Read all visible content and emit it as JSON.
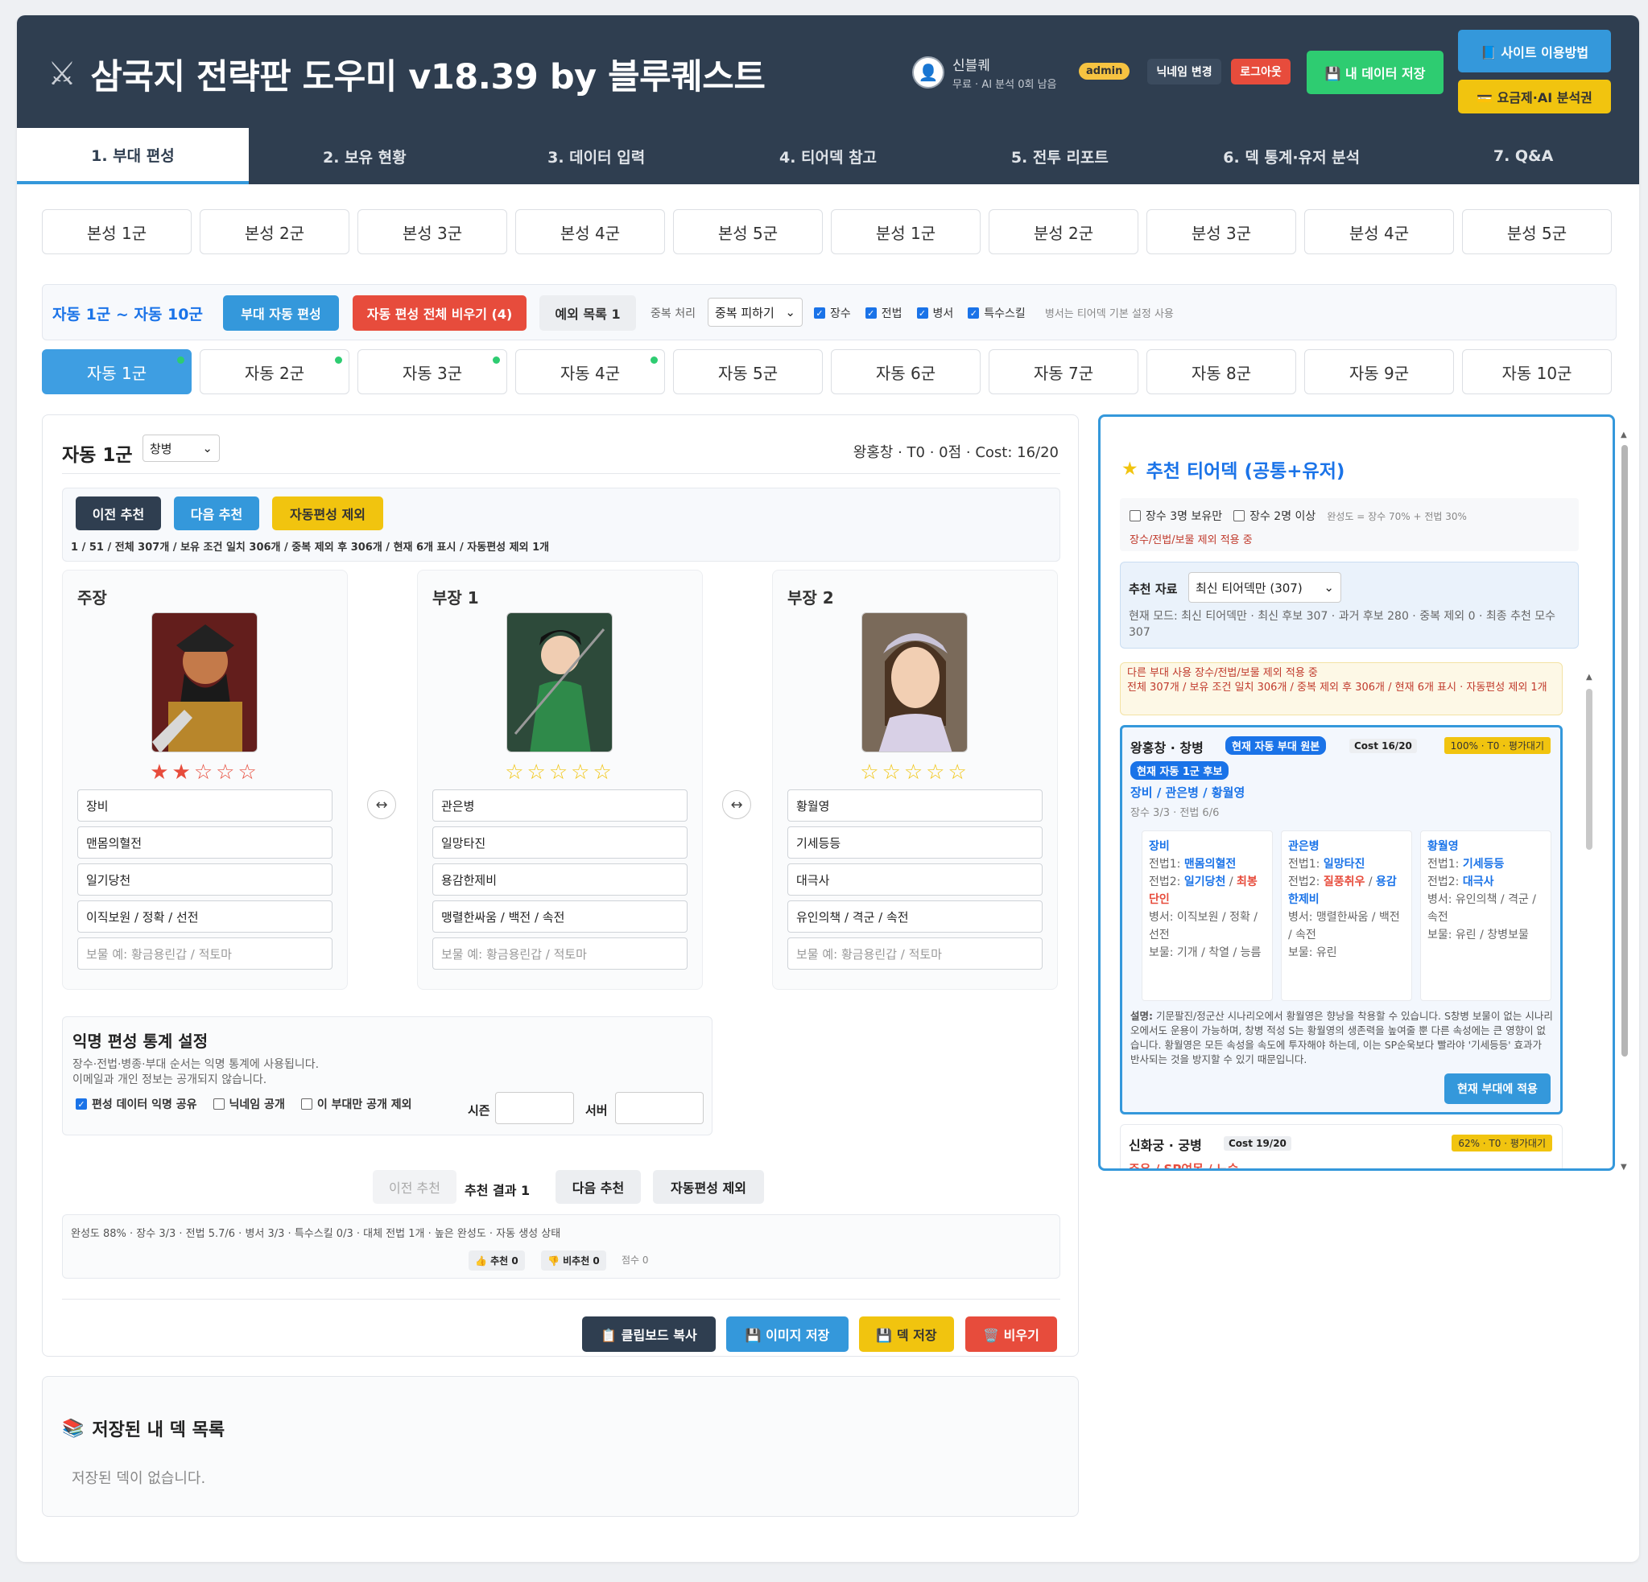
{
  "header": {
    "title": "삼국지 전략판 도우미 v18.39 by 블루퀘스트",
    "user_name": "신블퀘",
    "user_sub": "무료 · AI 분석 0회 남음",
    "admin_badge": "admin",
    "nickname_btn": "닉네임 변경",
    "logout_btn": "로그아웃",
    "save_data_btn": "💾 내 데이터 저장",
    "howto_btn": "📘 사이트 이용방법",
    "pricing_btn": "💳 요금제·AI 분석권"
  },
  "tabs": [
    "1. 부대 편성",
    "2. 보유 현황",
    "3. 데이터 입력",
    "4. 티어덱 참고",
    "5. 전투 리포트",
    "6. 덱 통계·유저 분석",
    "7. Q&A"
  ],
  "main_squads": [
    "본성 1군",
    "본성 2군",
    "본성 3군",
    "본성 4군",
    "본성 5군",
    "분성 1군",
    "분성 2군",
    "분성 3군",
    "분성 4군",
    "분성 5군"
  ],
  "auto_bar": {
    "title": "자동 1군 ~ 자동 10군",
    "auto_btn": "부대 자동 편성",
    "clear_btn": "자동 편성 전체 비우기 (4)",
    "except_btn": "예외 목록 1",
    "dup_label": "중복 처리",
    "dup_value": "중복 피하기",
    "checks": [
      "장수",
      "전법",
      "병서",
      "특수스킬"
    ],
    "note": "병서는 티어덱 기본 설정 사용"
  },
  "auto_squads": [
    "자동 1군",
    "자동 2군",
    "자동 3군",
    "자동 4군",
    "자동 5군",
    "자동 6군",
    "자동 7군",
    "자동 8군",
    "자동 9군",
    "자동 10군"
  ],
  "panel": {
    "title": "자동 1군",
    "troop": "창병",
    "summary": "왕홍창 · T0 · 0점 · Cost: 16/20",
    "prev_btn": "이전 추천",
    "next_btn": "다음 추천",
    "exclude_btn": "자동편성 제외",
    "info": "1 / 51 / 전체 307개 / 보유 조건 일치 306개 / 중복 제외 후 306개 / 현재 6개 표시 / 자동편성 제외 1개"
  },
  "slots": [
    {
      "label": "주장",
      "stars": "★★☆☆☆",
      "general": "장비",
      "skill1": "맨몸의혈전",
      "skill2": "일기당천",
      "book": "이직보원 / 정확 / 선전",
      "treasure_ph": "보물 예: 황금용린갑 / 적토마"
    },
    {
      "label": "부장 1",
      "stars": "☆☆☆☆☆",
      "general": "관은병",
      "skill1": "일망타진",
      "skill2": "용감한제비",
      "book": "맹렬한싸움 / 백전 / 속전",
      "treasure_ph": "보물 예: 황금용린갑 / 적토마"
    },
    {
      "label": "부장 2",
      "stars": "☆☆☆☆☆",
      "general": "황월영",
      "skill1": "기세등등",
      "skill2": "대극사",
      "book": "유인의책 / 격군 / 속전",
      "treasure_ph": "보물 예: 황금용린갑 / 적토마"
    }
  ],
  "anon": {
    "title": "익명 편성 통계 설정",
    "desc1": "장수·전법·병종·부대 순서는 익명 통계에 사용됩니다.",
    "desc2": "이메일과 개인 정보는 공개되지 않습니다.",
    "share": "편성 데이터 익명 공유",
    "nick": "닉네임 공개",
    "exclude": "이 부대만 공개 제외",
    "season": "시즌",
    "server": "서버"
  },
  "result": {
    "prev": "이전 추천",
    "label": "추천 결과 1",
    "next": "다음 추천",
    "exclude": "자동편성 제외",
    "stats": "완성도 88% · 장수 3/3 · 전법 5.7/6 · 병서 3/3 · 특수스킬 0/3 · 대체 전법 1개 · 높은 완성도 · 자동 생성 상태",
    "like": "👍 추천 0",
    "dislike": "👎 비추천 0",
    "score": "점수 0"
  },
  "actions": {
    "copy": "📋 클립보드 복사",
    "image": "💾 이미지 저장",
    "deck": "💾 덱 저장",
    "clear": "🗑️ 비우기"
  },
  "saved": {
    "title": "저장된 내 덱 목록",
    "empty": "저장된 덱이 없습니다."
  },
  "right": {
    "title": "추천 티어덱 (공통+유저)",
    "own3": "장수 3명 보유만",
    "own2": "장수 2명 이상",
    "formula": "완성도 = 장수 70% + 전법 30%",
    "applied": "장수/전법/보물 제외 적용 중",
    "src_label": "추천 자료",
    "src_value": "최신 티어덱만 (307)",
    "mode": "현재 모드: 최신 티어덱만 · 최신 후보 307 · 과거 후보 280 · 중복 제외 0 · 최종 추천 모수 307",
    "warn1": "다른 부대 사용 장수/전법/보물 제외 적용 중",
    "warn2": "전체 307개 / 보유 조건 일치 306개 / 중복 제외 후 306개 / 현재 6개 표시 · 자동편성 제외 1개",
    "rec1": {
      "name": "왕홍창 · 창병",
      "tag1": "현재 자동 부대 원본",
      "cost": "Cost 16/20",
      "pct": "100% · T0 · 평가대기",
      "tag2": "현재 자동 1군 후보",
      "members": "장비 / 관은병 / 황월영",
      "counts": "장수 3/3 · 전법 6/6",
      "cols": [
        {
          "name": "장비",
          "s1l": "전법1:",
          "s1": "맨몸의혈전",
          "s2l": "전법2:",
          "s2a": "일기당천",
          "s2b": "최봉단인",
          "book": "병서: 이직보원 / 정확 / 선전",
          "treasure": "보물: 기개 / 착열 / 능름"
        },
        {
          "name": "관은병",
          "s1l": "전법1:",
          "s1": "일망타진",
          "s2l": "전법2:",
          "s2a": "질풍취우",
          "s2b": "용감한제비",
          "book": "병서: 맹렬한싸움 / 백전 / 속전",
          "treasure": "보물: 유린"
        },
        {
          "name": "황월영",
          "s1l": "전법1:",
          "s1": "기세등등",
          "s2l": "전법2:",
          "s2a": "대극사",
          "s2b": "",
          "book": "병서: 유인의책 / 격군 / 속전",
          "treasure": "보물: 유린 / 창병보물"
        }
      ],
      "desc_label": "설명:",
      "desc": "기문팔진/정군산 시나리오에서 황월영은 향낭을 착용할 수 있습니다. S창병 보물이 없는 시나리오에서도 운용이 가능하며, 창병 적성 S는 황월영의 생존력을 높여줄 뿐 다른 속성에는 큰 영향이 없습니다. 황월영은 모든 속성을 속도에 투자해야 하는데, 이는 SP순욱보다 빨라야 '기세등등' 효과가 반사되는 것을 방지할 수 있기 때문입니다.",
      "apply_btn": "현재 부대에 적용"
    },
    "rec2": {
      "name": "신화궁 · 궁병",
      "cost": "Cost 19/20",
      "pct": "62% · T0 · 평가대기",
      "members": "주유 / SP여몽 / 노숙"
    }
  },
  "colors": {
    "header": "#2f3e50",
    "accent": "#3498db",
    "danger": "#e74c3c",
    "success": "#2ecc71",
    "warning": "#f1c40f"
  }
}
